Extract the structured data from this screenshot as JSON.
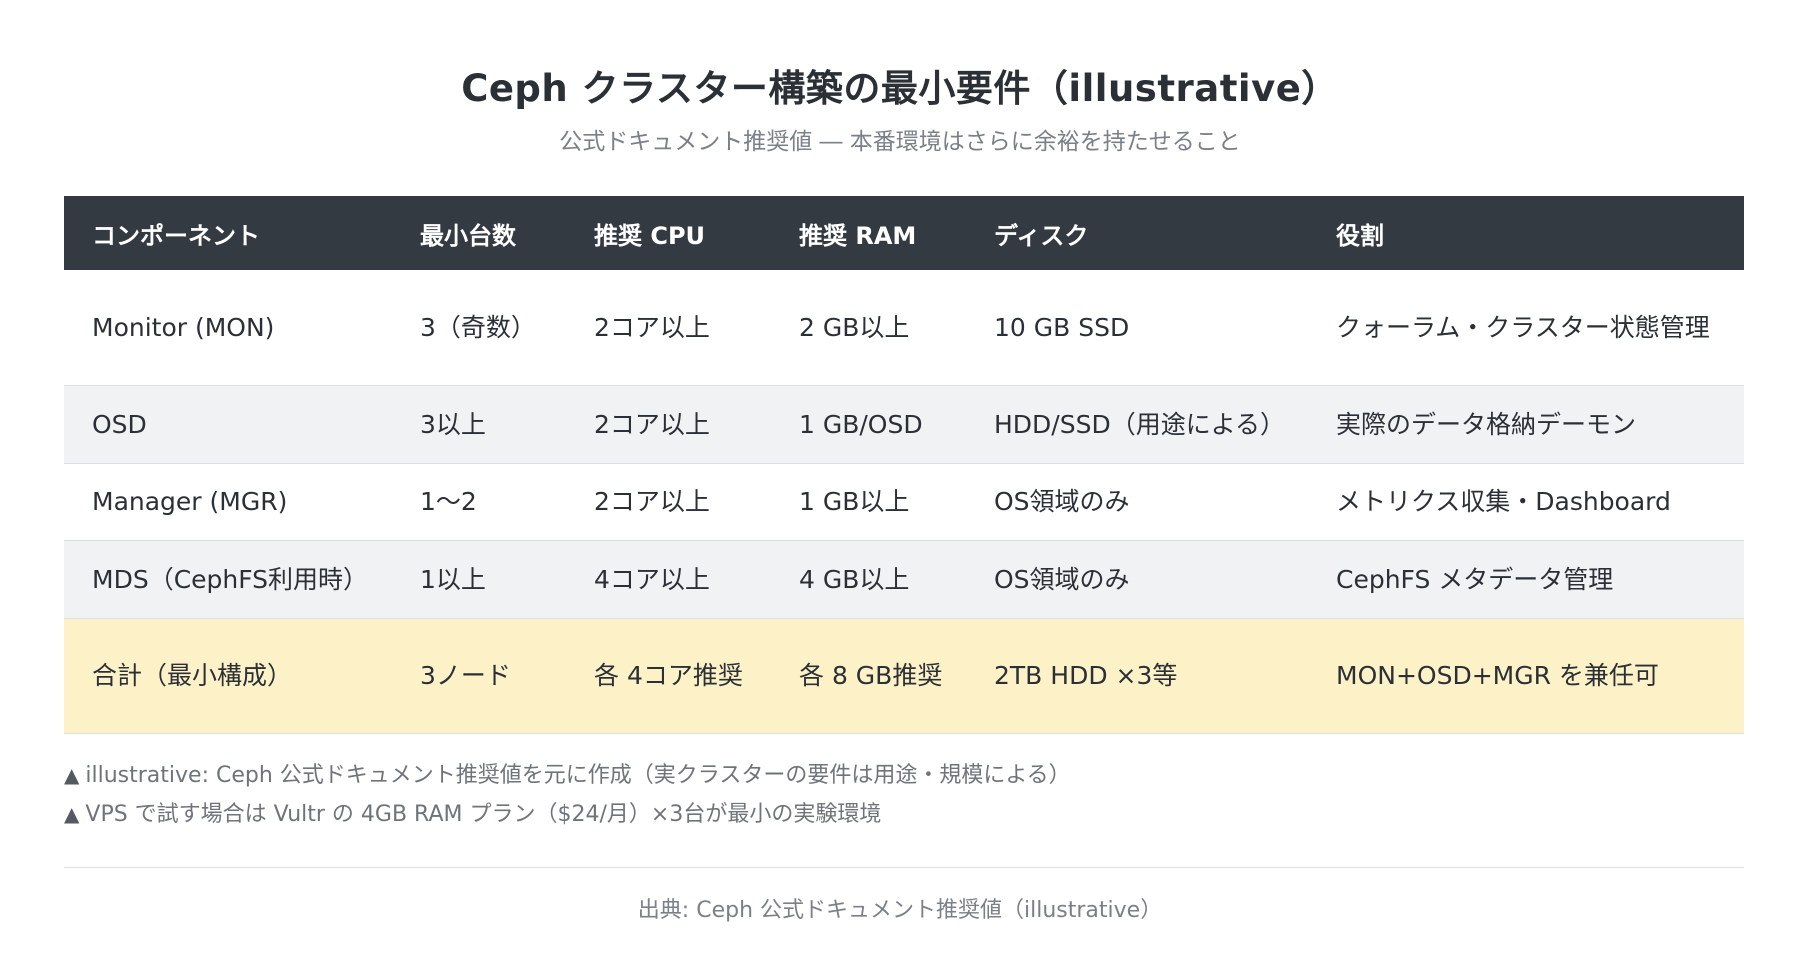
{
  "header": {
    "title": "Ceph クラスター構築の最小要件（illustrative）",
    "subtitle": "公式ドキュメント推奨値 ― 本番環境はさらに余裕を持たせること"
  },
  "table": {
    "columns": [
      "コンポーネント",
      "最小台数",
      "推奨 CPU",
      "推奨 RAM",
      "ディスク",
      "役割"
    ],
    "rows": [
      [
        "Monitor (MON)",
        "3（奇数）",
        "2コア以上",
        "2 GB以上",
        "10 GB SSD",
        "クォーラム・クラスター状態管理"
      ],
      [
        "OSD",
        "3以上",
        "2コア以上",
        "1 GB/OSD",
        "HDD/SSD（用途による）",
        "実際のデータ格納デーモン"
      ],
      [
        "Manager (MGR)",
        "1〜2",
        "2コア以上",
        "1 GB以上",
        "OS領域のみ",
        "メトリクス収集・Dashboard"
      ],
      [
        "MDS（CephFS利用時）",
        "1以上",
        "4コア以上",
        "4 GB以上",
        "OS領域のみ",
        "CephFS メタデータ管理"
      ],
      [
        "合計（最小構成）",
        "3ノード",
        "各 4コア推奨",
        "各 8 GB推奨",
        "2TB HDD ×3等",
        "MON+OSD+MGR を兼任可"
      ]
    ]
  },
  "notes": {
    "mark": "▲",
    "items": [
      "illustrative: Ceph 公式ドキュメント推奨値を元に作成（実クラスターの要件は用途・規模による）",
      "VPS で試す場合は Vultr の 4GB RAM プラン（$24/月）×3台が最小の実験環境"
    ]
  },
  "footer": {
    "source": "出典: Ceph 公式ドキュメント推奨値（illustrative）"
  }
}
